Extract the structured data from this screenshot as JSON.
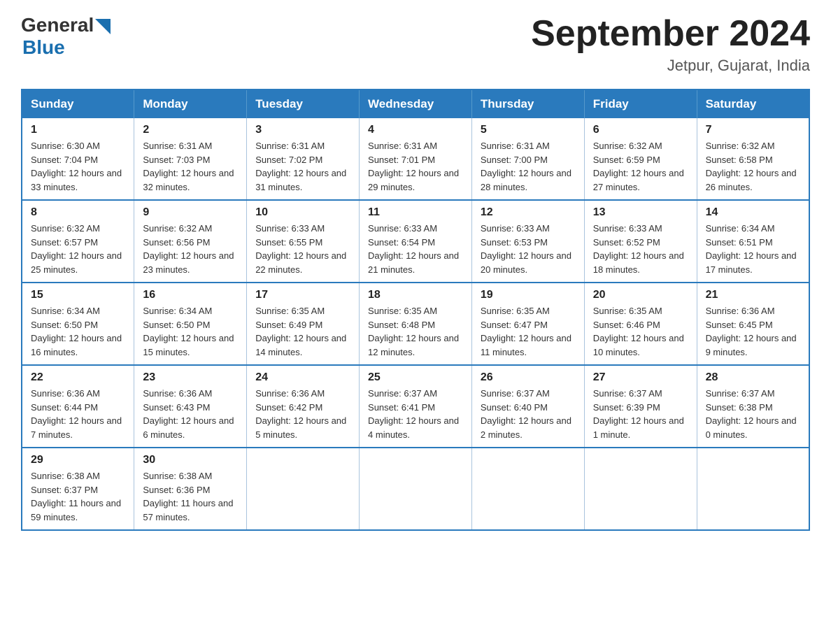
{
  "header": {
    "logo_general": "General",
    "logo_blue": "Blue",
    "month_title": "September 2024",
    "location": "Jetpur, Gujarat, India"
  },
  "days_of_week": [
    "Sunday",
    "Monday",
    "Tuesday",
    "Wednesday",
    "Thursday",
    "Friday",
    "Saturday"
  ],
  "weeks": [
    [
      {
        "day": "1",
        "sunrise": "Sunrise: 6:30 AM",
        "sunset": "Sunset: 7:04 PM",
        "daylight": "Daylight: 12 hours and 33 minutes."
      },
      {
        "day": "2",
        "sunrise": "Sunrise: 6:31 AM",
        "sunset": "Sunset: 7:03 PM",
        "daylight": "Daylight: 12 hours and 32 minutes."
      },
      {
        "day": "3",
        "sunrise": "Sunrise: 6:31 AM",
        "sunset": "Sunset: 7:02 PM",
        "daylight": "Daylight: 12 hours and 31 minutes."
      },
      {
        "day": "4",
        "sunrise": "Sunrise: 6:31 AM",
        "sunset": "Sunset: 7:01 PM",
        "daylight": "Daylight: 12 hours and 29 minutes."
      },
      {
        "day": "5",
        "sunrise": "Sunrise: 6:31 AM",
        "sunset": "Sunset: 7:00 PM",
        "daylight": "Daylight: 12 hours and 28 minutes."
      },
      {
        "day": "6",
        "sunrise": "Sunrise: 6:32 AM",
        "sunset": "Sunset: 6:59 PM",
        "daylight": "Daylight: 12 hours and 27 minutes."
      },
      {
        "day": "7",
        "sunrise": "Sunrise: 6:32 AM",
        "sunset": "Sunset: 6:58 PM",
        "daylight": "Daylight: 12 hours and 26 minutes."
      }
    ],
    [
      {
        "day": "8",
        "sunrise": "Sunrise: 6:32 AM",
        "sunset": "Sunset: 6:57 PM",
        "daylight": "Daylight: 12 hours and 25 minutes."
      },
      {
        "day": "9",
        "sunrise": "Sunrise: 6:32 AM",
        "sunset": "Sunset: 6:56 PM",
        "daylight": "Daylight: 12 hours and 23 minutes."
      },
      {
        "day": "10",
        "sunrise": "Sunrise: 6:33 AM",
        "sunset": "Sunset: 6:55 PM",
        "daylight": "Daylight: 12 hours and 22 minutes."
      },
      {
        "day": "11",
        "sunrise": "Sunrise: 6:33 AM",
        "sunset": "Sunset: 6:54 PM",
        "daylight": "Daylight: 12 hours and 21 minutes."
      },
      {
        "day": "12",
        "sunrise": "Sunrise: 6:33 AM",
        "sunset": "Sunset: 6:53 PM",
        "daylight": "Daylight: 12 hours and 20 minutes."
      },
      {
        "day": "13",
        "sunrise": "Sunrise: 6:33 AM",
        "sunset": "Sunset: 6:52 PM",
        "daylight": "Daylight: 12 hours and 18 minutes."
      },
      {
        "day": "14",
        "sunrise": "Sunrise: 6:34 AM",
        "sunset": "Sunset: 6:51 PM",
        "daylight": "Daylight: 12 hours and 17 minutes."
      }
    ],
    [
      {
        "day": "15",
        "sunrise": "Sunrise: 6:34 AM",
        "sunset": "Sunset: 6:50 PM",
        "daylight": "Daylight: 12 hours and 16 minutes."
      },
      {
        "day": "16",
        "sunrise": "Sunrise: 6:34 AM",
        "sunset": "Sunset: 6:50 PM",
        "daylight": "Daylight: 12 hours and 15 minutes."
      },
      {
        "day": "17",
        "sunrise": "Sunrise: 6:35 AM",
        "sunset": "Sunset: 6:49 PM",
        "daylight": "Daylight: 12 hours and 14 minutes."
      },
      {
        "day": "18",
        "sunrise": "Sunrise: 6:35 AM",
        "sunset": "Sunset: 6:48 PM",
        "daylight": "Daylight: 12 hours and 12 minutes."
      },
      {
        "day": "19",
        "sunrise": "Sunrise: 6:35 AM",
        "sunset": "Sunset: 6:47 PM",
        "daylight": "Daylight: 12 hours and 11 minutes."
      },
      {
        "day": "20",
        "sunrise": "Sunrise: 6:35 AM",
        "sunset": "Sunset: 6:46 PM",
        "daylight": "Daylight: 12 hours and 10 minutes."
      },
      {
        "day": "21",
        "sunrise": "Sunrise: 6:36 AM",
        "sunset": "Sunset: 6:45 PM",
        "daylight": "Daylight: 12 hours and 9 minutes."
      }
    ],
    [
      {
        "day": "22",
        "sunrise": "Sunrise: 6:36 AM",
        "sunset": "Sunset: 6:44 PM",
        "daylight": "Daylight: 12 hours and 7 minutes."
      },
      {
        "day": "23",
        "sunrise": "Sunrise: 6:36 AM",
        "sunset": "Sunset: 6:43 PM",
        "daylight": "Daylight: 12 hours and 6 minutes."
      },
      {
        "day": "24",
        "sunrise": "Sunrise: 6:36 AM",
        "sunset": "Sunset: 6:42 PM",
        "daylight": "Daylight: 12 hours and 5 minutes."
      },
      {
        "day": "25",
        "sunrise": "Sunrise: 6:37 AM",
        "sunset": "Sunset: 6:41 PM",
        "daylight": "Daylight: 12 hours and 4 minutes."
      },
      {
        "day": "26",
        "sunrise": "Sunrise: 6:37 AM",
        "sunset": "Sunset: 6:40 PM",
        "daylight": "Daylight: 12 hours and 2 minutes."
      },
      {
        "day": "27",
        "sunrise": "Sunrise: 6:37 AM",
        "sunset": "Sunset: 6:39 PM",
        "daylight": "Daylight: 12 hours and 1 minute."
      },
      {
        "day": "28",
        "sunrise": "Sunrise: 6:37 AM",
        "sunset": "Sunset: 6:38 PM",
        "daylight": "Daylight: 12 hours and 0 minutes."
      }
    ],
    [
      {
        "day": "29",
        "sunrise": "Sunrise: 6:38 AM",
        "sunset": "Sunset: 6:37 PM",
        "daylight": "Daylight: 11 hours and 59 minutes."
      },
      {
        "day": "30",
        "sunrise": "Sunrise: 6:38 AM",
        "sunset": "Sunset: 6:36 PM",
        "daylight": "Daylight: 11 hours and 57 minutes."
      },
      null,
      null,
      null,
      null,
      null
    ]
  ]
}
